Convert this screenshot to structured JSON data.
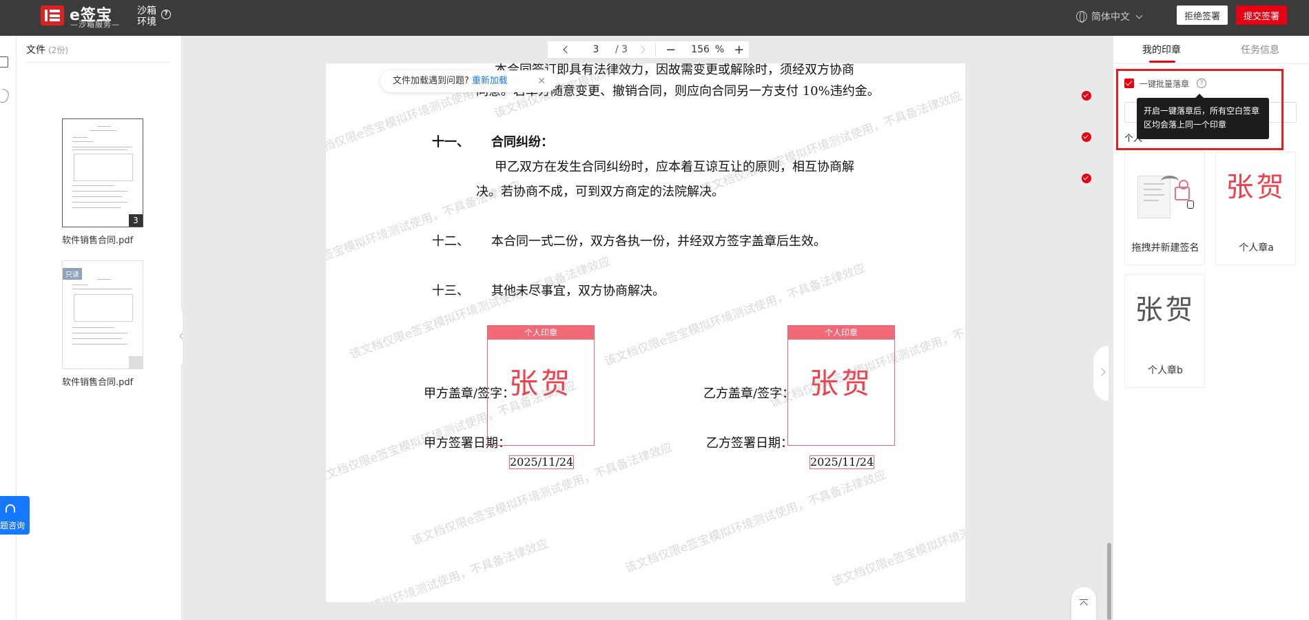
{
  "header": {
    "logo_name": "e签宝",
    "logo_sub": "—沙箱服务—",
    "sandbox_label": "沙箱环境",
    "language": "简体中文",
    "reject_label": "拒绝签署",
    "submit_label": "提交签署"
  },
  "files": {
    "title": "文件",
    "count": "(2份)",
    "items": [
      {
        "name": "软件销售合同.pdf",
        "pages": "3",
        "tag": ""
      },
      {
        "name": "软件销售合同.pdf",
        "pages": "",
        "tag": "只读"
      }
    ]
  },
  "support_label": "题咨询",
  "toolbar": {
    "current_page": "3",
    "total_pages": "/ 3",
    "zoom": "156",
    "zoom_unit": "%"
  },
  "load_notice": {
    "text": "文件加载遇到问题?",
    "action": "重新加载"
  },
  "document": {
    "line_top1": "本合同签订即具有法律效力，因故需变更或解除时，须经双方协商",
    "line_top2": "同意。若单方随意变更、撤销合同，则应向合同另一方支付 10%违约金。",
    "sec11_num": "十一、",
    "sec11_title": "合同纠纷：",
    "sec11_l1": "甲乙双方在发生合同纠纷时，应本着互谅互让的原则，相互协商解",
    "sec11_l2": "决。若协商不成，可到双方商定的法院解决。",
    "sec12_num": "十二、",
    "sec12_text": "本合同一式二份，双方各执一份，并经双方签字盖章后生效。",
    "sec13_num": "十三、",
    "sec13_text": "其他未尽事宜，双方协商解决。",
    "party_a_seal": "甲方盖章/签字：",
    "party_a_date": "甲方签署日期：",
    "party_b_seal": "乙方盖章/签字：",
    "party_b_date": "乙方签署日期：",
    "seal_header": "个人印章",
    "seal_name": "张贺",
    "date_value": "2025/11/24",
    "watermark": "该文档仅限e签宝模拟环境测试使用，不具备法律效应"
  },
  "right_panel": {
    "tab_seals": "我的印章",
    "tab_task": "任务信息",
    "batch_label": "一键批量落章",
    "tooltip_l1": "开启一键落章后，所有空白签章",
    "tooltip_l2": "区均会落上同一个印章",
    "personal_label": "个人",
    "cards": [
      {
        "label": "拖拽并新建签名"
      },
      {
        "label": "个人章a",
        "seal": "张贺"
      },
      {
        "label": "个人章b",
        "seal": "张贺"
      }
    ]
  },
  "colors": {
    "brand_red": "#e60012",
    "link_blue": "#1677ff",
    "seal_red": "#f0404e"
  }
}
